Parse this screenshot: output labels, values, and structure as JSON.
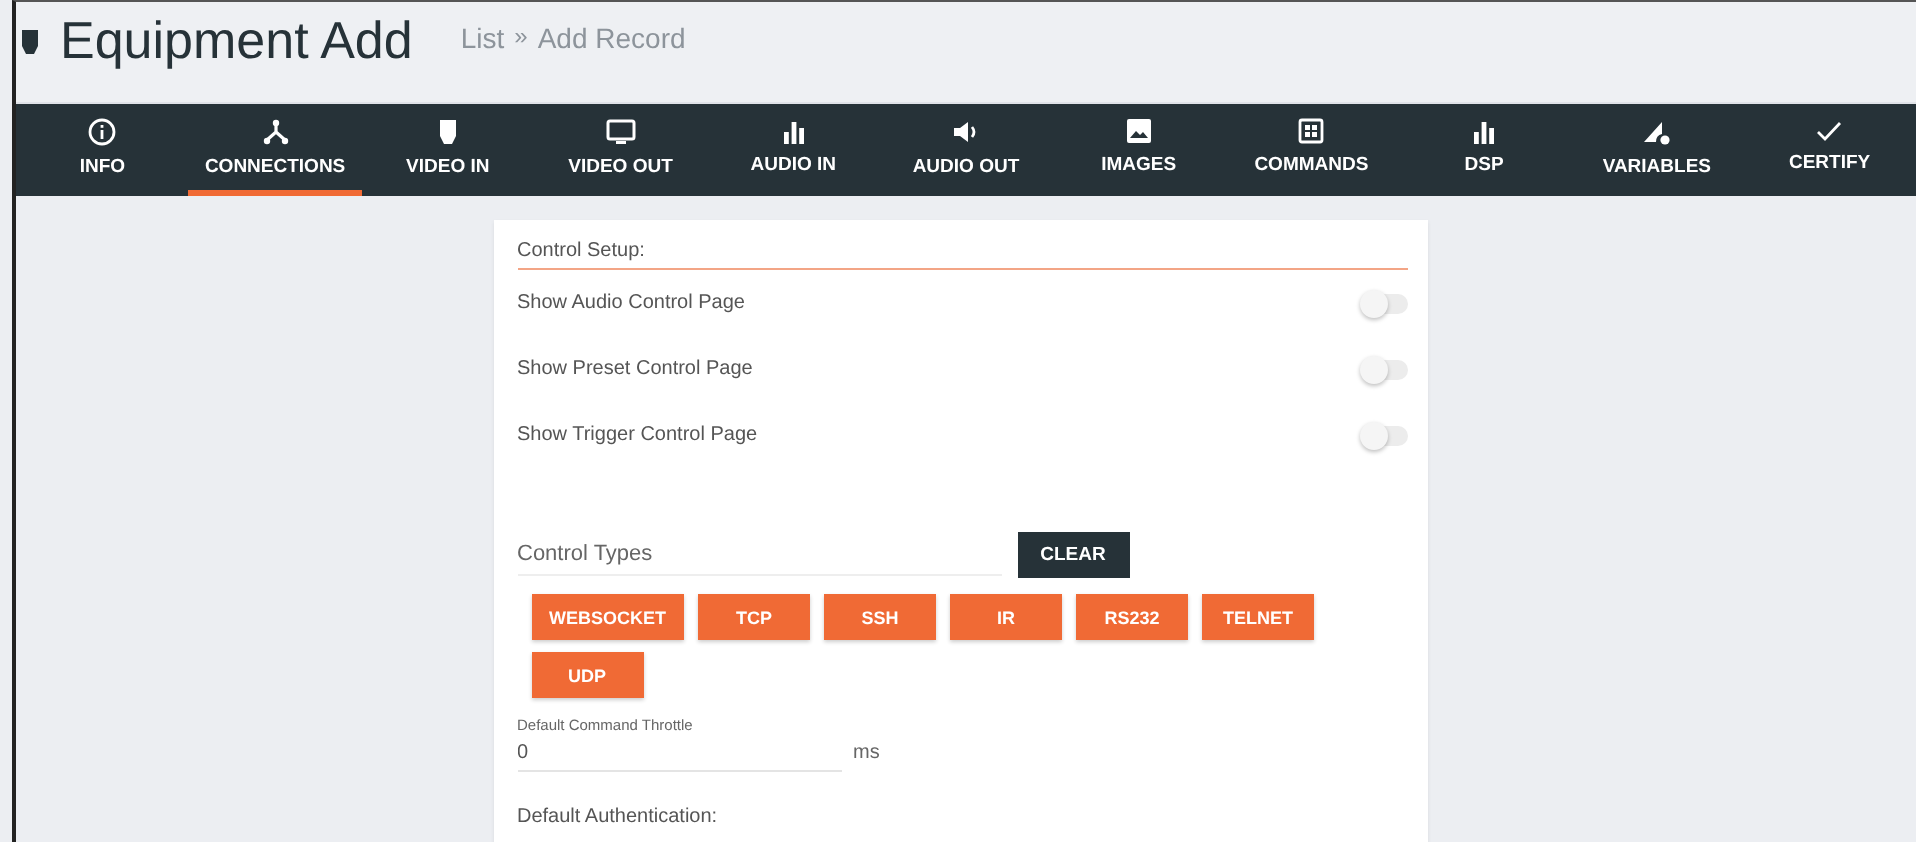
{
  "header": {
    "title": "Equipment Add",
    "breadcrumb": [
      {
        "label": "List"
      },
      {
        "label": "»"
      },
      {
        "label": "Add Record"
      }
    ]
  },
  "tabs": [
    {
      "label": "INFO",
      "selected": false
    },
    {
      "label": "CONNECTIONS",
      "selected": true
    },
    {
      "label": "VIDEO IN",
      "selected": false
    },
    {
      "label": "VIDEO OUT",
      "selected": false
    },
    {
      "label": "AUDIO IN",
      "selected": false
    },
    {
      "label": "AUDIO OUT",
      "selected": false
    },
    {
      "label": "IMAGES",
      "selected": false
    },
    {
      "label": "COMMANDS",
      "selected": false
    },
    {
      "label": "DSP",
      "selected": false
    },
    {
      "label": "VARIABLES",
      "selected": false
    },
    {
      "label": "CERTIFY",
      "selected": false
    }
  ],
  "control_setup": {
    "heading": "Control Setup:",
    "toggles": [
      {
        "label": "Show Audio Control Page",
        "on": false
      },
      {
        "label": "Show Preset Control Page",
        "on": false
      },
      {
        "label": "Show Trigger Control Page",
        "on": false
      }
    ]
  },
  "control_types": {
    "placeholder": "Control Types",
    "clear_button": "CLEAR",
    "types": [
      "WEBSOCKET",
      "TCP",
      "SSH",
      "IR",
      "RS232",
      "TELNET",
      "UDP"
    ]
  },
  "throttle": {
    "label": "Default Command Throttle",
    "value": "0",
    "unit": "ms"
  },
  "authentication": {
    "label": "Default Authentication:"
  }
}
